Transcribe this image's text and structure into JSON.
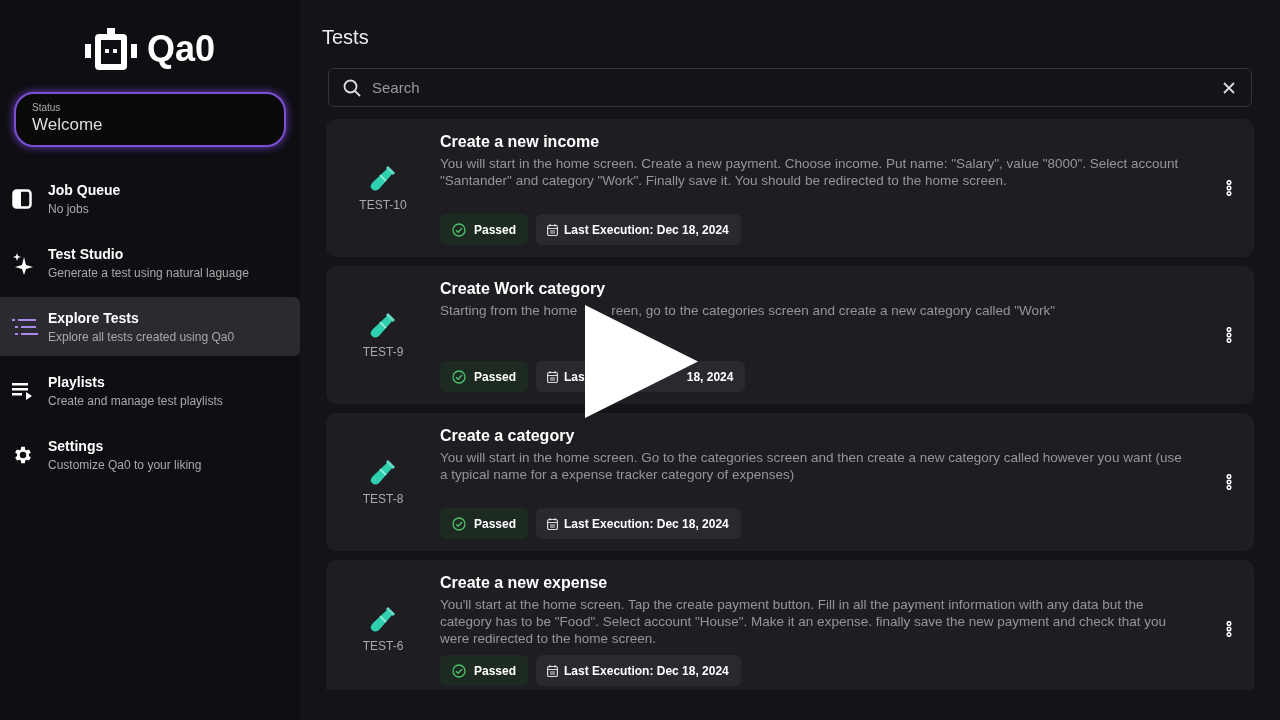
{
  "app": {
    "name": "Qa0"
  },
  "status": {
    "label": "Status",
    "value": "Welcome"
  },
  "nav": [
    {
      "title": "Job Queue",
      "subtitle": "No jobs",
      "selected": false
    },
    {
      "title": "Test Studio",
      "subtitle": "Generate a test using natural laguage",
      "selected": false
    },
    {
      "title": "Explore Tests",
      "subtitle": "Explore all tests created using Qa0",
      "selected": true
    },
    {
      "title": "Playlists",
      "subtitle": "Create and manage test playlists",
      "selected": false
    },
    {
      "title": "Settings",
      "subtitle": "Customize Qa0 to your liking",
      "selected": false
    }
  ],
  "page": {
    "title": "Tests"
  },
  "search": {
    "placeholder": "Search"
  },
  "tests": [
    {
      "id": "TEST-10",
      "title": "Create a new income",
      "description": [
        "You will start in the home screen. Create a new payment. Choose income. Put name: \"Salary\", value \"8000\". Select account \"Santander\" and category \"Work\". Finally save it. You should be redirected to the home screen."
      ],
      "status": "Passed",
      "last_execution": [
        "Last Execution: Dec 18, 2024"
      ]
    },
    {
      "id": "TEST-9",
      "title": "Create Work category",
      "description": [
        "Starting from the home",
        "reen, go to the categories screen and create a new category called \"Work\""
      ],
      "status": "Passed",
      "last_execution": [
        "Las",
        "18, 2024"
      ]
    },
    {
      "id": "TEST-8",
      "title": "Create a category",
      "description": [
        "You will start in the home screen. Go to the categories screen and then create a new category called however you want (use a typical name for a expense tracker category of expenses)"
      ],
      "status": "Passed",
      "last_execution": [
        "Last Execution: Dec 18, 2024"
      ]
    },
    {
      "id": "TEST-6",
      "title": "Create a new expense",
      "description": [
        "You'll start at the home screen. Tap the create payment button. Fill in all the payment information with any data but the category has to be \"Food\". Select account \"House\". Make it an expense. finally save the new payment and check that you were redirected to the home screen."
      ],
      "status": "Passed",
      "last_execution": [
        "Last Execution: Dec 18, 2024"
      ]
    }
  ]
}
